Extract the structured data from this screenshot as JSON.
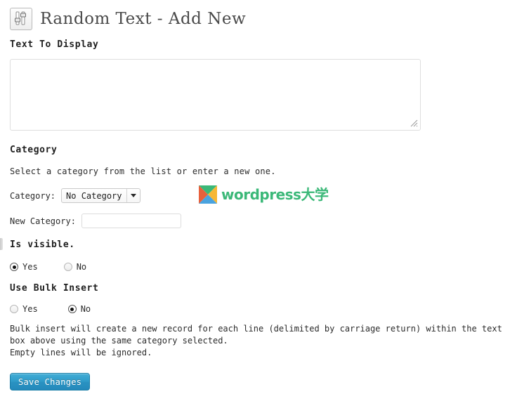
{
  "page": {
    "title": "Random Text - Add New",
    "icon": "sliders-settings-icon"
  },
  "sections": {
    "text_to_display": {
      "heading": "Text To Display",
      "textarea_value": "",
      "textarea_placeholder": ""
    },
    "category": {
      "heading": "Category",
      "hint": "Select a category from the list or enter a new one.",
      "select_label": "Category:",
      "select_value": "No Category",
      "select_options": [
        "No Category"
      ],
      "new_category_label": "New Category:",
      "new_category_value": "",
      "new_category_placeholder": ""
    },
    "is_visible": {
      "heading": "Is visible.",
      "yes_label": "Yes",
      "no_label": "No",
      "selected": "Yes"
    },
    "bulk_insert": {
      "heading": "Use Bulk Insert",
      "yes_label": "Yes",
      "no_label": "No",
      "selected": "No",
      "description": "Bulk insert will create a new record for each line (delimited by carriage return) within the text box above using the same category selected.\nEmpty lines will be ignored."
    }
  },
  "actions": {
    "save_label": "Save Changes"
  },
  "watermark": {
    "text": "wordpress大学",
    "mark_colors": {
      "top": "#3bb878",
      "right": "#f7b733",
      "bottom": "#4aa3df",
      "left": "#e8603c"
    }
  },
  "colors": {
    "accent_blue": "#2e9bc9",
    "heading_text": "#1f1f1f",
    "body_text": "#2b2b2b",
    "title_text": "#4a4a4a",
    "border": "#dedede",
    "watermark_green": "#3bb878"
  }
}
